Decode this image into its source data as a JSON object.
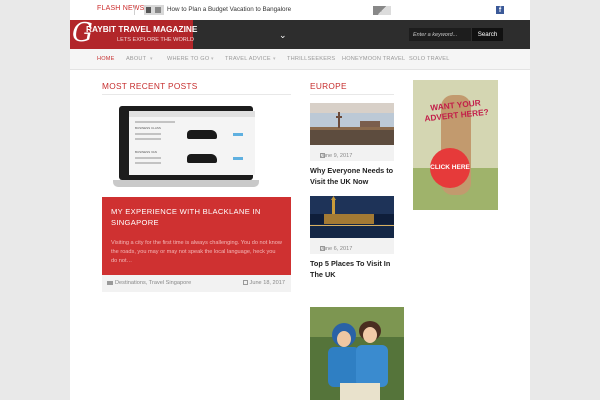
{
  "flash": {
    "label": "FLASH NEWS",
    "headline": "How to Plan a Budget Vacation to Bangalore",
    "social_icon": "facebook-icon",
    "social_glyph": "f"
  },
  "header": {
    "logo_letter": "G",
    "logo_title": "RAYBIT TRAVEL MAGAZINE",
    "logo_tagline": "LETS EXPLORE THE WORLD",
    "menu_chevron": "⌄",
    "search_placeholder": "Enter a keyword...",
    "search_button": "Search"
  },
  "nav": {
    "items": [
      {
        "label": "HOME",
        "active": true
      },
      {
        "label": "ABOUT",
        "has_dropdown": true
      },
      {
        "label": "WHERE TO GO",
        "has_dropdown": true
      },
      {
        "label": "TRAVEL ADVICE",
        "has_dropdown": true
      },
      {
        "label": "THRILLSEEKERS"
      },
      {
        "label": "HONEYMOON TRAVEL"
      },
      {
        "label": "SOLO TRAVEL"
      }
    ],
    "dropdown_glyph": "▾"
  },
  "recent": {
    "heading": "MOST RECENT POSTS",
    "feature": {
      "title": "MY EXPERIENCE WITH BLACKLANE IN SINGAPORE",
      "excerpt": "Visiting a city for the first time is always challenging. You do not know the roads, you may or may not speak the local language, heck you do not…",
      "categories": "Destinations, Travel Singapore",
      "date": "June 18, 2017",
      "screen_labels": [
        "BUSINESS CLASS",
        "BUSINESS VAN"
      ]
    }
  },
  "europe": {
    "heading": "EUROPE",
    "posts": [
      {
        "date": "June 9, 2017",
        "title": "Why Everyone Needs to Visit the UK Now"
      },
      {
        "date": "June 6, 2017",
        "title": "Top 5 Places To Visit In The UK"
      }
    ]
  },
  "ad": {
    "text": "WANT YOUR ADVERT HERE?",
    "cta": "CLICK HERE"
  },
  "colors": {
    "accent": "#cf3131",
    "header_bg": "#2d2d2d",
    "logo_bg": "#b2262a"
  }
}
